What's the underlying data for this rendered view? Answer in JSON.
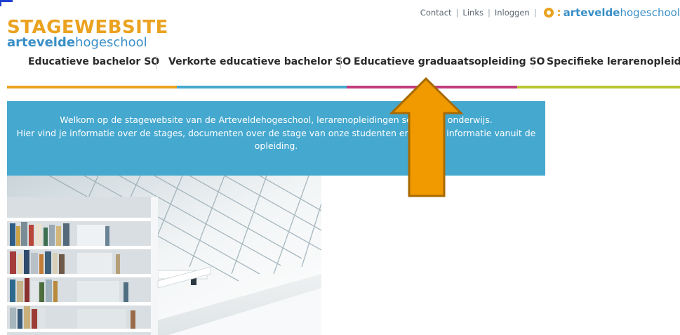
{
  "header": {
    "logo_line1": "STAGEWEBSITE",
    "logo_line2_bold": "artevelde",
    "logo_line2_rest": "hogeschool"
  },
  "toplinks": [
    {
      "label": "Contact"
    },
    {
      "label": "Links"
    },
    {
      "label": "Inloggen"
    }
  ],
  "brand": {
    "bold": "artevelde",
    "rest": "hogeschool"
  },
  "nav": [
    {
      "label": "Educatieve bachelor SO"
    },
    {
      "label": "Verkorte educatieve bachelor SO"
    },
    {
      "label": "Educatieve graduaatsopleiding SO"
    },
    {
      "label": "Specifieke lerarenopleiding"
    }
  ],
  "colors": {
    "orange": "#eaa21f",
    "blue": "#45a8cf",
    "magenta": "#c13c7c",
    "lime": "#b9c531",
    "arrow": "#f09a00"
  },
  "welcome": {
    "line1": "Welkom op de stagewebsite van de Arteveldehogeschool, lerarenopleidingen secundair onderwijs.",
    "line2": "Hier vind je informatie over de stages, documenten over de stage van onze studenten en andere informatie vanuit de",
    "line3": "opleiding."
  }
}
